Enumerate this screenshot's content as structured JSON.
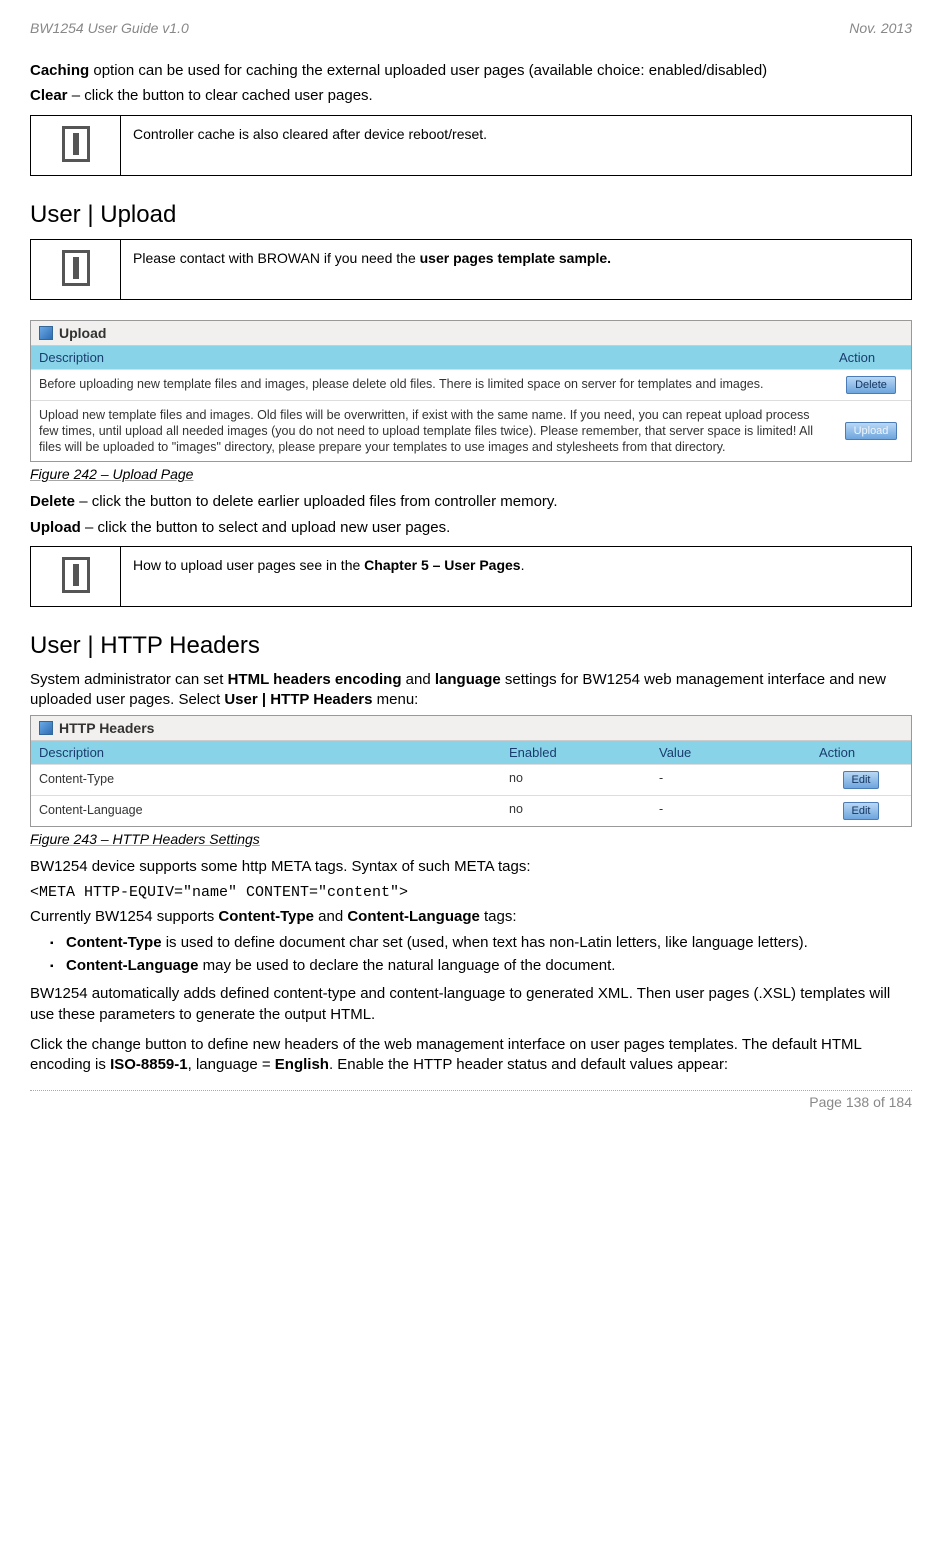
{
  "header": {
    "left": "BW1254 User Guide v1.0",
    "right": "Nov.  2013"
  },
  "intro": {
    "cachingPrefix": "Caching",
    "cachingText": " option can be used for caching the external uploaded user pages (available choice: enabled/disabled)",
    "clearPrefix": "Clear",
    "clearText": " – click the button to clear cached user pages.",
    "infoNote1": "Controller cache is also cleared after device reboot/reset."
  },
  "upload": {
    "heading": "User | Upload",
    "notePrefix": "Please contact with BROWAN if you need the ",
    "noteBold": "user pages template sample.",
    "ssTitle": "Upload",
    "colDesc": "Description",
    "colAction": "Action",
    "row1Text": "Before uploading new template files and images, please delete old files. There is limited space on server for templates and images.",
    "row1Btn": "Delete",
    "row2Text": "Upload new template files and images. Old files will be overwritten, if exist with the same name. If you need, you can repeat upload process few times, until upload all needed images (you do not need to upload template files twice). Please remember, that server space is limited! All files will be uploaded to \"images\" directory, please prepare your templates to use images and stylesheets from that directory.",
    "row2Btn": "Upload",
    "caption": "Figure 242 – Upload Page",
    "deletePrefix": "Delete",
    "deleteText": " – click the button to delete earlier uploaded files from controller memory.",
    "uploadPrefix": "Upload",
    "uploadText": " – click the button to select and upload new user pages.",
    "infoNote2a": "How to upload user pages see in the ",
    "infoNote2b": "Chapter 5 – User Pages",
    "infoNote2c": "."
  },
  "http": {
    "heading": "User | HTTP Headers",
    "intro1a": "System administrator can set ",
    "intro1b": "HTML headers encoding",
    "intro1c": " and ",
    "intro1d": "language",
    "intro1e": " settings for BW1254 web management interface and new uploaded user pages. Select ",
    "intro1f": "User | HTTP Headers",
    "intro1g": " menu:",
    "ssTitle": "HTTP Headers",
    "colDesc": "Description",
    "colEnabled": "Enabled",
    "colValue": "Value",
    "colAction": "Action",
    "r1Desc": "Content-Type",
    "r1En": "no",
    "r1Val": "-",
    "r2Desc": "Content-Language",
    "r2En": "no",
    "r2Val": "-",
    "editBtn": "Edit",
    "caption": "Figure 243 – HTTP Headers Settings",
    "p1": "BW1254 device supports some http META tags. Syntax of such META tags:",
    "code": "<META HTTP-EQUIV=\"name\" CONTENT=\"content\">",
    "p2a": "Currently BW1254 supports ",
    "p2b": "Content-Type",
    "p2c": " and ",
    "p2d": "Content-Language",
    "p2e": " tags:",
    "li1a": "Content-Type",
    "li1b": " is used to define document char set (used, when text has non-Latin letters, like language letters).",
    "li2a": "Content-Language",
    "li2b": " may be used to declare the natural language of the document.",
    "p3": "BW1254 automatically adds defined content-type and content-language to generated XML. Then user pages (.XSL) templates will use these parameters to generate the output HTML.",
    "p4a": "Click the change button to define new headers of the web management interface on user pages templates. The default HTML encoding is ",
    "p4b": "ISO-8859-1",
    "p4c": ", language = ",
    "p4d": "English",
    "p4e": ". Enable the HTTP header status and default values appear:"
  },
  "footer": "Page 138 of 184"
}
